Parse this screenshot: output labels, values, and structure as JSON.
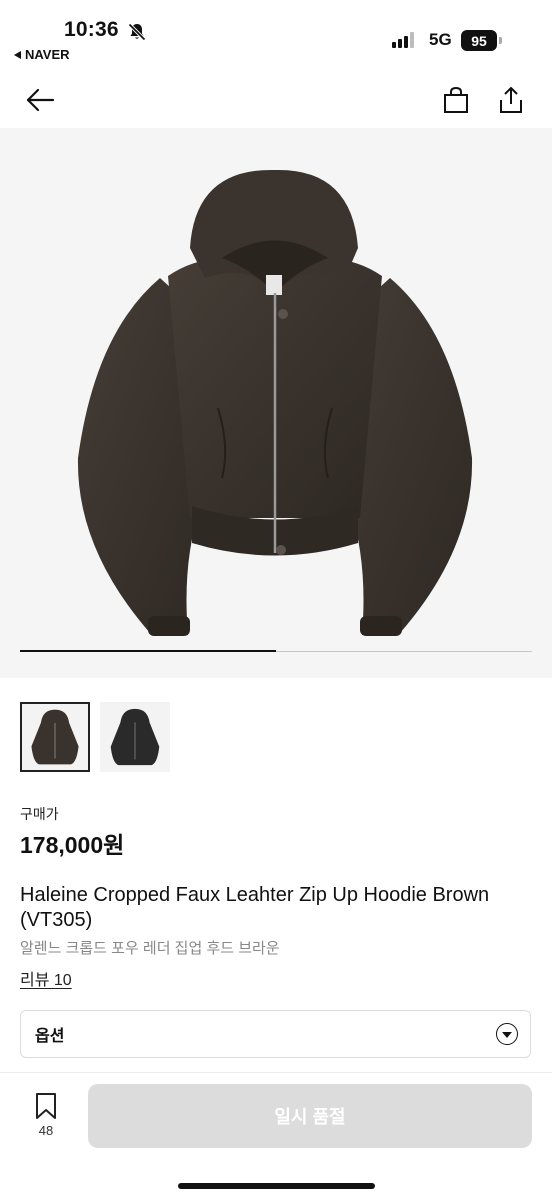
{
  "status_bar": {
    "time": "10:36",
    "back_app": "NAVER",
    "network": "5G",
    "battery": "95",
    "icons": [
      "bell-off-icon",
      "signal-icon",
      "battery-icon"
    ]
  },
  "nav": {
    "icons": [
      "back-arrow-icon",
      "shopping-bag-icon",
      "share-icon"
    ]
  },
  "gallery": {
    "image_count": 2,
    "current_index": 1,
    "progress_fraction": 0.5
  },
  "product": {
    "price_label": "구매가",
    "price": "178,000원",
    "name": "Haleine Cropped Faux Leahter Zip Up Hoodie Brown (VT305)",
    "name_kr": "알렌느 크롭드 포우 레더 집업 후드 브라운",
    "review": "리뷰 10"
  },
  "option": {
    "label": "옵션"
  },
  "bottom_bar": {
    "wish_count": "48",
    "sold_out_label": "일시 품절"
  },
  "colors": {
    "jacket_brown": "#3a332d",
    "jacket_black": "#2a2a2a",
    "disabled_button": "#dcdcdc"
  }
}
